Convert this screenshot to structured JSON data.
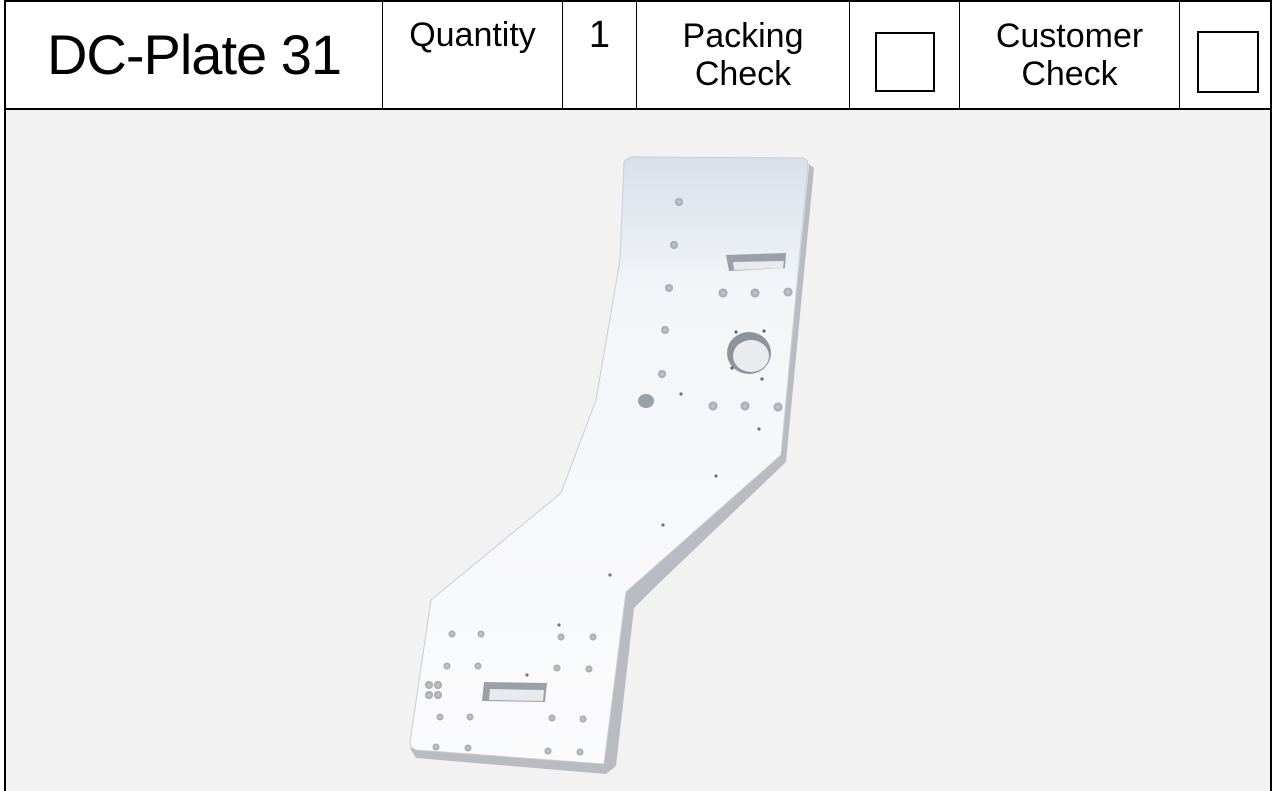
{
  "header": {
    "part_name": "DC-Plate 31",
    "quantity_label": "Quantity",
    "quantity_value": "1",
    "packing_check_line1": "Packing",
    "packing_check_line2": "Check",
    "customer_check_line1": "Customer",
    "customer_check_line2": "Check"
  },
  "checks": {
    "packing_checked": false,
    "customer_checked": false
  },
  "image": {
    "subject": "bent-plate-render",
    "plate_color": "#f7f8fa",
    "background_color": "#f2f2f2"
  }
}
